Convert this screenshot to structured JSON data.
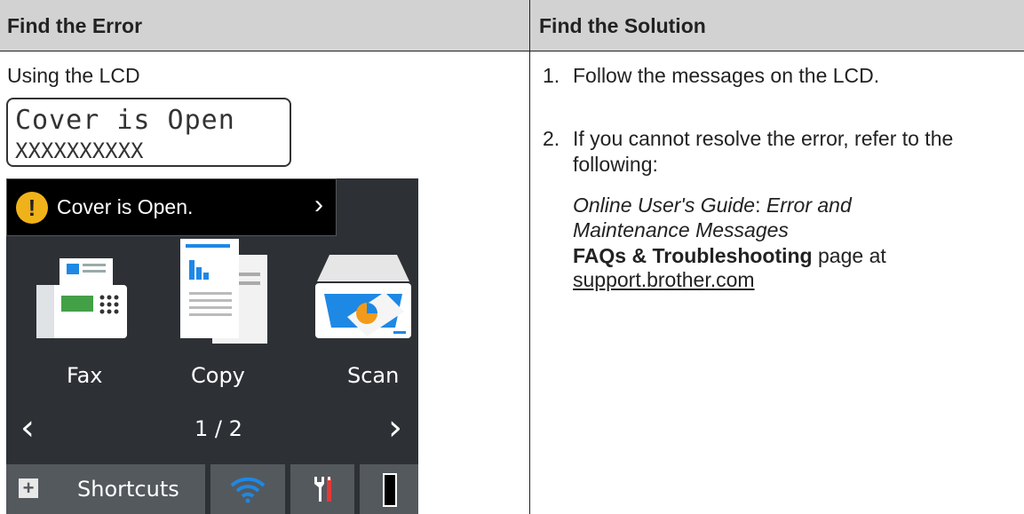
{
  "header": {
    "left": "Find the Error",
    "right": "Find the Solution"
  },
  "error": {
    "using_label": "Using the LCD",
    "lcd_line1": "Cover is Open",
    "lcd_line2": "XXXXXXXXXX",
    "touchscreen": {
      "alert_text": "Cover is Open.",
      "apps": [
        "Fax",
        "Copy",
        "Scan"
      ],
      "page_indicator": "1 / 2",
      "shortcuts_label": "Shortcuts"
    }
  },
  "solution": {
    "step1_num": "1.",
    "step1_text": "Follow the messages on the LCD.",
    "step2_num": "2.",
    "step2_line1": "If you cannot resolve the error, refer to the",
    "step2_line2": "following:",
    "guide_title": "Online User's Guide",
    "guide_sep": ":",
    "guide_section_line1": "Error and",
    "guide_section_line2": "Maintenance Messages",
    "faq_bold": "FAQs & Troubleshooting",
    "faq_rest": "page at",
    "link": "support.brother.com"
  },
  "colors": {
    "header_bg": "#d2d2d2",
    "screen_bg": "#2d3136",
    "alert_yellow": "#f0b21a",
    "button_bg": "#54595e",
    "wifi_blue": "#1e88e5",
    "tools_red": "#e53935"
  }
}
